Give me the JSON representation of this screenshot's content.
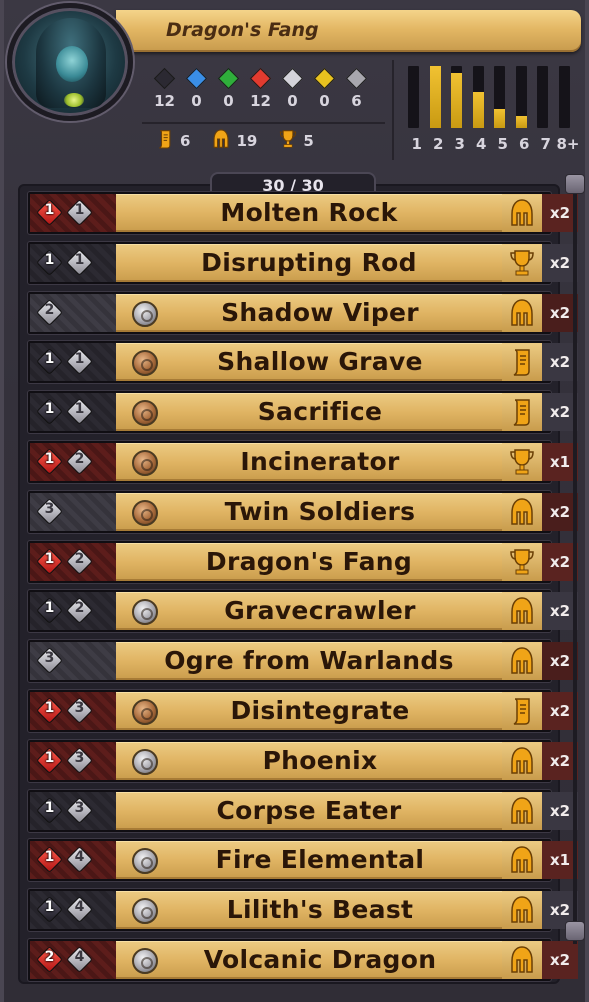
{
  "deck": {
    "title": "Dragon's Fang",
    "count_label": "30 / 30",
    "gems": [
      {
        "icon": "black-gem-icon",
        "color": "#2b2932",
        "count": "12"
      },
      {
        "icon": "blue-gem-icon",
        "color": "#3a8ee6",
        "count": "0"
      },
      {
        "icon": "green-gem-icon",
        "color": "#2fae3b",
        "count": "0"
      },
      {
        "icon": "red-gem-icon",
        "color": "#e23b2f",
        "count": "12"
      },
      {
        "icon": "white-gem-icon",
        "color": "#d4d3da",
        "count": "0"
      },
      {
        "icon": "yellow-gem-icon",
        "color": "#e8c21f",
        "count": "0"
      },
      {
        "icon": "grey-gem-icon",
        "color": "#a8a7ae",
        "count": "6"
      }
    ],
    "types": [
      {
        "icon": "scroll-icon",
        "count": "6"
      },
      {
        "icon": "helmet-icon",
        "count": "19"
      },
      {
        "icon": "trophy-icon",
        "count": "5"
      }
    ],
    "mana_curve": {
      "labels": [
        "1",
        "2",
        "3",
        "4",
        "5",
        "6",
        "7",
        "8+"
      ],
      "fraction": [
        0,
        1.0,
        0.88,
        0.58,
        0.3,
        0.2,
        0,
        0
      ]
    }
  },
  "cards": [
    {
      "name": "Molten Rock",
      "row": "red",
      "gems": [
        {
          "c": "red",
          "v": "1"
        },
        {
          "c": "white",
          "v": "1"
        }
      ],
      "coin": "",
      "type": "helmet",
      "qty": "x2"
    },
    {
      "name": "Disrupting Rod",
      "row": "dark",
      "gems": [
        {
          "c": "black",
          "v": "1"
        },
        {
          "c": "white",
          "v": "1"
        }
      ],
      "coin": "",
      "type": "trophy",
      "qty": "x2"
    },
    {
      "name": "Shadow Viper",
      "row": "grey",
      "gems": [
        {
          "c": "white",
          "v": "2"
        }
      ],
      "coin": "silver",
      "type": "helmet",
      "qty": "x2"
    },
    {
      "name": "Shallow Grave",
      "row": "dark",
      "gems": [
        {
          "c": "black",
          "v": "1"
        },
        {
          "c": "white",
          "v": "1"
        }
      ],
      "coin": "bronze",
      "type": "scroll",
      "qty": "x2"
    },
    {
      "name": "Sacrifice",
      "row": "dark",
      "gems": [
        {
          "c": "black",
          "v": "1"
        },
        {
          "c": "white",
          "v": "1"
        }
      ],
      "coin": "bronze",
      "type": "scroll",
      "qty": "x2"
    },
    {
      "name": "Incinerator",
      "row": "red",
      "gems": [
        {
          "c": "red",
          "v": "1"
        },
        {
          "c": "white",
          "v": "2"
        }
      ],
      "coin": "bronze",
      "type": "trophy",
      "qty": "x1"
    },
    {
      "name": "Twin Soldiers",
      "row": "grey",
      "gems": [
        {
          "c": "white",
          "v": "3"
        }
      ],
      "coin": "bronze",
      "type": "helmet",
      "qty": "x2"
    },
    {
      "name": "Dragon's Fang",
      "row": "red",
      "gems": [
        {
          "c": "red",
          "v": "1"
        },
        {
          "c": "white",
          "v": "2"
        }
      ],
      "coin": "",
      "type": "trophy",
      "qty": "x2"
    },
    {
      "name": "Gravecrawler",
      "row": "dark",
      "gems": [
        {
          "c": "black",
          "v": "1"
        },
        {
          "c": "white",
          "v": "2"
        }
      ],
      "coin": "silver",
      "type": "helmet",
      "qty": "x2"
    },
    {
      "name": "Ogre from Warlands",
      "row": "grey",
      "gems": [
        {
          "c": "white",
          "v": "3"
        }
      ],
      "coin": "",
      "type": "helmet",
      "qty": "x2"
    },
    {
      "name": "Disintegrate",
      "row": "red",
      "gems": [
        {
          "c": "red",
          "v": "1"
        },
        {
          "c": "white",
          "v": "3"
        }
      ],
      "coin": "bronze",
      "type": "scroll",
      "qty": "x2"
    },
    {
      "name": "Phoenix",
      "row": "red",
      "gems": [
        {
          "c": "red",
          "v": "1"
        },
        {
          "c": "white",
          "v": "3"
        }
      ],
      "coin": "silver",
      "type": "helmet",
      "qty": "x2"
    },
    {
      "name": "Corpse Eater",
      "row": "dark",
      "gems": [
        {
          "c": "black",
          "v": "1"
        },
        {
          "c": "white",
          "v": "3"
        }
      ],
      "coin": "",
      "type": "helmet",
      "qty": "x2"
    },
    {
      "name": "Fire Elemental",
      "row": "red",
      "gems": [
        {
          "c": "red",
          "v": "1"
        },
        {
          "c": "white",
          "v": "4"
        }
      ],
      "coin": "silver",
      "type": "helmet",
      "qty": "x1"
    },
    {
      "name": "Lilith's Beast",
      "row": "dark",
      "gems": [
        {
          "c": "black",
          "v": "1"
        },
        {
          "c": "white",
          "v": "4"
        }
      ],
      "coin": "silver",
      "type": "helmet",
      "qty": "x2"
    },
    {
      "name": "Volcanic Dragon",
      "row": "red",
      "gems": [
        {
          "c": "red",
          "v": "2"
        },
        {
          "c": "white",
          "v": "4"
        }
      ],
      "coin": "silver",
      "type": "helmet",
      "qty": "x2"
    }
  ]
}
